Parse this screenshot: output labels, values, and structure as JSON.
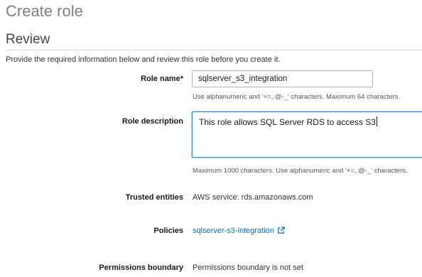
{
  "page": {
    "title": "Create role",
    "section_title": "Review",
    "intro": "Provide the required information below and review this role before you create it."
  },
  "role_name": {
    "label": "Role name",
    "required_marker": "*",
    "value": "sqlserver_s3_integration",
    "hint": "Use alphanumeric and '+=,.@-_' characters. Maximum 64 characters."
  },
  "role_description": {
    "label": "Role description",
    "value": "This role allows SQL Server RDS to access S3",
    "hint": "Maximum 1000 characters. Use alphanumeric and '+=,.@-_' characters."
  },
  "trusted_entities": {
    "label": "Trusted entities",
    "value": "AWS service: rds.amazonaws.com"
  },
  "policies": {
    "label": "Policies",
    "link_text": "sqlserver-s3-integration",
    "icon": "external-link-icon"
  },
  "permissions_boundary": {
    "label": "Permissions boundary",
    "value": "Permissions boundary is not set"
  },
  "colors": {
    "link": "#0073bb",
    "focus_border": "#2e8bd9",
    "title_gray": "#7f7f7f"
  }
}
